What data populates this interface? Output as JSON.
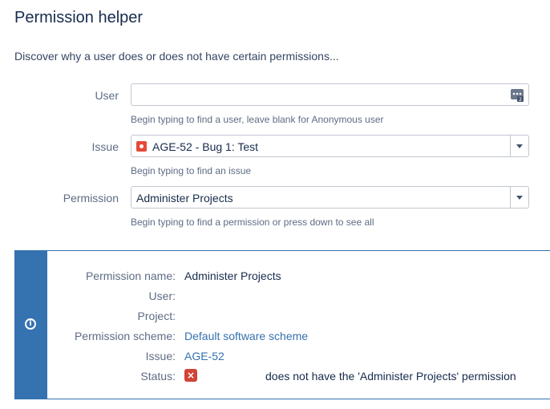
{
  "page": {
    "title": "Permission helper",
    "subtitle": "Discover why a user does or does not have certain permissions..."
  },
  "form": {
    "user": {
      "label": "User",
      "value": "",
      "help": "Begin typing to find a user, leave blank for Anonymous user",
      "icon": "user-picker-icon"
    },
    "issue": {
      "label": "Issue",
      "value": "AGE-52 - Bug 1:  Test",
      "help": "Begin typing to find an issue",
      "icon": "bug-icon"
    },
    "permission": {
      "label": "Permission",
      "value": "Administer Projects",
      "help": "Begin typing to find a permission or press down to see all"
    }
  },
  "result": {
    "icon": "info-icon",
    "rows": {
      "permission_name": {
        "label": "Permission name:",
        "value": "Administer Projects"
      },
      "user": {
        "label": "User:",
        "value": ""
      },
      "project": {
        "label": "Project:",
        "value": ""
      },
      "permission_scheme": {
        "label": "Permission scheme:",
        "value": "Default software scheme"
      },
      "issue": {
        "label": "Issue:",
        "value": "AGE-52"
      },
      "status": {
        "label": "Status:",
        "value": "does not have the 'Administer Projects' permission",
        "icon": "error-x-icon"
      }
    }
  },
  "colors": {
    "accent": "#3572b0",
    "error": "#d04437",
    "bug": "#e5493a"
  }
}
